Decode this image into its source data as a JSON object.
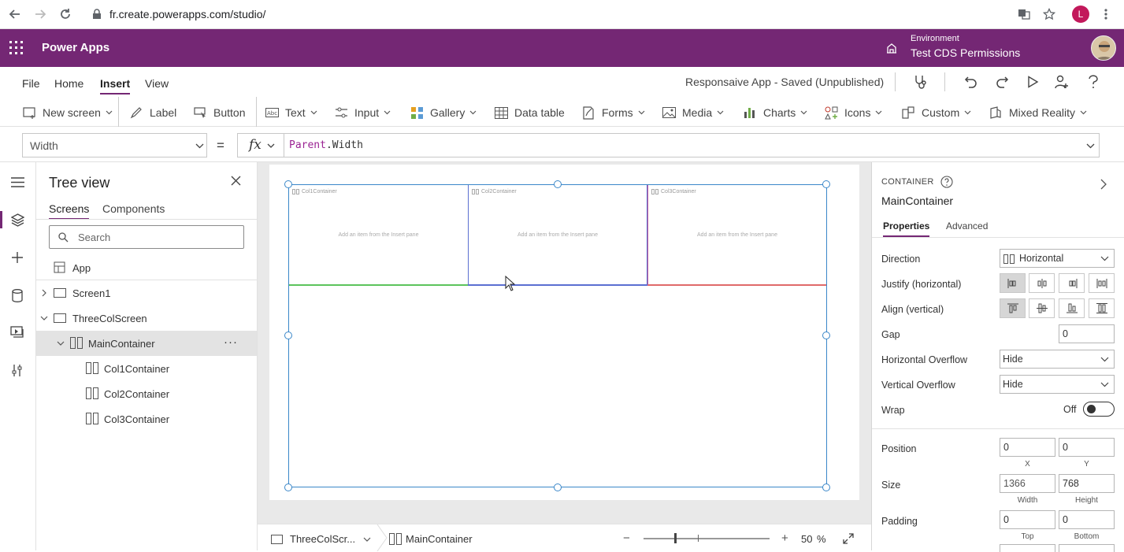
{
  "browser": {
    "url": "fr.create.powerapps.com/studio/",
    "profile_initial": "L",
    "profile_color": "#c2185b"
  },
  "appbar": {
    "title": "Power Apps",
    "environment_label": "Environment",
    "environment_name": "Test CDS Permissions",
    "brand_color": "#742774"
  },
  "menu": {
    "items": [
      "File",
      "Home",
      "Insert",
      "View"
    ],
    "active": "Insert",
    "save_status": "Responsaive App - Saved (Unpublished)"
  },
  "ribbon": {
    "items": [
      {
        "label": "New screen",
        "icon": "new-screen-icon",
        "dropdown": true
      },
      {
        "label": "Label",
        "icon": "label-icon",
        "dropdown": false
      },
      {
        "label": "Button",
        "icon": "button-icon",
        "dropdown": false
      },
      {
        "label": "Text",
        "icon": "text-icon",
        "dropdown": true
      },
      {
        "label": "Input",
        "icon": "input-icon",
        "dropdown": true
      },
      {
        "label": "Gallery",
        "icon": "gallery-icon",
        "dropdown": true
      },
      {
        "label": "Data table",
        "icon": "data-table-icon",
        "dropdown": false
      },
      {
        "label": "Forms",
        "icon": "forms-icon",
        "dropdown": true
      },
      {
        "label": "Media",
        "icon": "media-icon",
        "dropdown": true
      },
      {
        "label": "Charts",
        "icon": "charts-icon",
        "dropdown": true
      },
      {
        "label": "Icons",
        "icon": "icons-icon",
        "dropdown": true
      },
      {
        "label": "Custom",
        "icon": "custom-icon",
        "dropdown": true
      },
      {
        "label": "Mixed Reality",
        "icon": "mixed-reality-icon",
        "dropdown": true
      }
    ]
  },
  "formula": {
    "property": "Width",
    "equals": "=",
    "fx": "fx",
    "keyword": "Parent",
    "rest": ".Width"
  },
  "tree": {
    "title": "Tree view",
    "tabs": [
      "Screens",
      "Components"
    ],
    "search_placeholder": "Search",
    "app_label": "App",
    "rows": [
      {
        "label": "Screen1"
      },
      {
        "label": "ThreeColScreen"
      },
      {
        "label": "MainContainer",
        "more": "···"
      },
      {
        "label": "Col1Container"
      },
      {
        "label": "Col2Container"
      },
      {
        "label": "Col3Container"
      }
    ]
  },
  "canvas": {
    "columns": [
      {
        "label": "Col1Container",
        "hint": "Add an item from the Insert pane",
        "color": "#5cc35c"
      },
      {
        "label": "Col2Container",
        "hint": "Add an item from the Insert pane",
        "color": "#5b6fd1"
      },
      {
        "label": "Col3Container",
        "hint": "Add an item from the Insert pane",
        "color": "#e06a6a"
      }
    ],
    "selection_color": "#3a87c9"
  },
  "statusbar": {
    "screen": "ThreeColScr...",
    "control": "MainContainer",
    "minus": "−",
    "plus": "+",
    "zoom": "50",
    "zoom_unit": "%"
  },
  "props": {
    "control_type": "CONTAINER",
    "control_name": "MainContainer",
    "tabs": [
      "Properties",
      "Advanced"
    ],
    "direction_label": "Direction",
    "direction_value": "Horizontal",
    "justify_label": "Justify (horizontal)",
    "align_label": "Align (vertical)",
    "gap_label": "Gap",
    "gap_value": "0",
    "hoverflow_label": "Horizontal Overflow",
    "hoverflow_value": "Hide",
    "voverflow_label": "Vertical Overflow",
    "voverflow_value": "Hide",
    "wrap_label": "Wrap",
    "wrap_value": "Off",
    "position_label": "Position",
    "position_x": "0",
    "position_y": "0",
    "x_caption": "X",
    "y_caption": "Y",
    "size_label": "Size",
    "width_value": "1366",
    "height_value": "768",
    "width_caption": "Width",
    "height_caption": "Height",
    "padding_label": "Padding",
    "padding_top": "0",
    "padding_bottom": "0",
    "top_caption": "Top",
    "bottom_caption": "Bottom"
  }
}
